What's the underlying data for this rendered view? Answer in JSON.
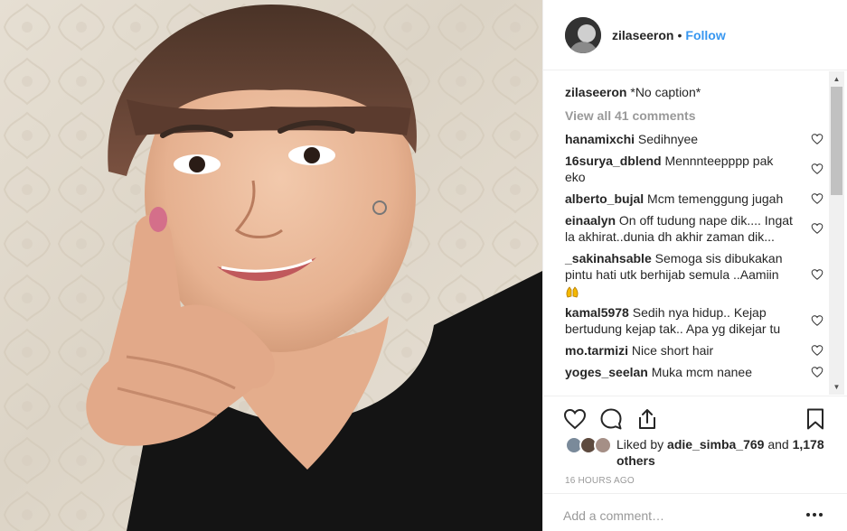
{
  "post": {
    "username": "zilaseeron",
    "separator": "•",
    "follow_label": "Follow"
  },
  "caption": {
    "username": "zilaseeron",
    "text": "*No caption*"
  },
  "view_all_comments": "View all 41 comments",
  "comments": [
    {
      "username": "hanamixchi",
      "text": "Sedihnyee"
    },
    {
      "username": "16surya_dblend",
      "text": "Mennnteepppp pak eko"
    },
    {
      "username": "alberto_bujal",
      "text": "Mcm temenggung jugah"
    },
    {
      "username": "einaalyn",
      "text": "On off tudung nape dik.... Ingat la akhirat..dunia dh akhir zaman dik..."
    },
    {
      "username": "_sakinahsable",
      "text": "Semoga sis dibukakan pintu hati utk berhijab semula ..Aamiin"
    },
    {
      "username": "kamal5978",
      "text": "Sedih nya hidup.. Kejap bertudung kejap tak.. Apa yg dikejar tu"
    },
    {
      "username": "mo.tarmizi",
      "text": "Nice short hair"
    },
    {
      "username": "yoges_seelan",
      "text": "Muka mcm nanee"
    }
  ],
  "likes": {
    "prefix": "Liked by",
    "user": "adie_simba_769",
    "conjunction": "and",
    "others": "1,178 others"
  },
  "timestamp": "16 HOURS AGO",
  "add_comment": {
    "placeholder": "Add a comment…"
  },
  "icons": {
    "like": "heart-icon",
    "comment": "comment-bubble-icon",
    "share": "share-icon",
    "save": "bookmark-icon",
    "more": "more-options-icon",
    "comment_like": "small-heart-icon",
    "emoji": "praying-hands-emoji"
  },
  "colors": {
    "link": "#3897f0",
    "muted": "#999999",
    "text": "#262626",
    "border": "#efefef"
  }
}
